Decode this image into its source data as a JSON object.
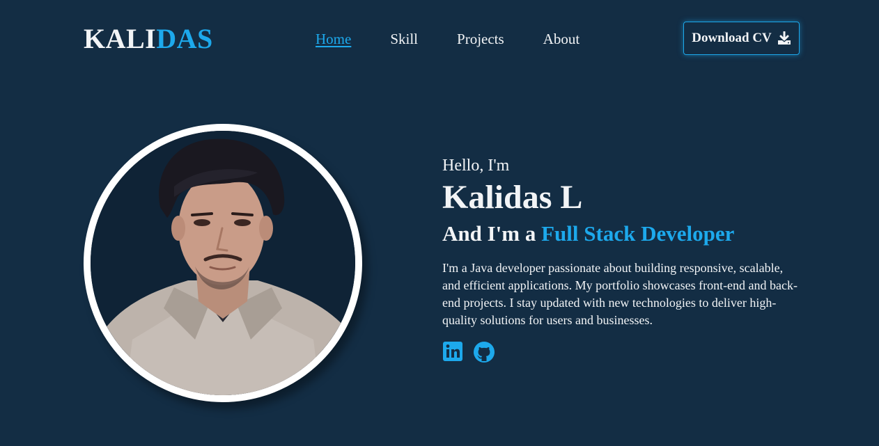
{
  "header": {
    "logo_primary": "KALI",
    "logo_accent": "DAS",
    "nav": [
      {
        "label": "Home",
        "active": true
      },
      {
        "label": "Skill",
        "active": false
      },
      {
        "label": "Projects",
        "active": false
      },
      {
        "label": "About",
        "active": false
      }
    ],
    "cta_label": "Download CV",
    "cta_icon": "download-icon"
  },
  "profile": {
    "photo_alt": "Kalidas L profile photo"
  },
  "hero": {
    "greeting": "Hello, I'm",
    "name": "Kalidas L",
    "role_prefix": "And I'm a ",
    "role_highlight": "Full Stack Developer",
    "bio": "I'm a Java developer passionate about building responsive, scalable, and efficient applications. My portfolio showcases front-end and back-end projects. I stay updated with new technologies to deliver high-quality solutions for users and businesses.",
    "socials": [
      {
        "icon": "linkedin-icon"
      },
      {
        "icon": "github-icon"
      }
    ]
  },
  "colors": {
    "background": "#132d44",
    "accent": "#1da9ec",
    "text": "#f2f4f6"
  }
}
